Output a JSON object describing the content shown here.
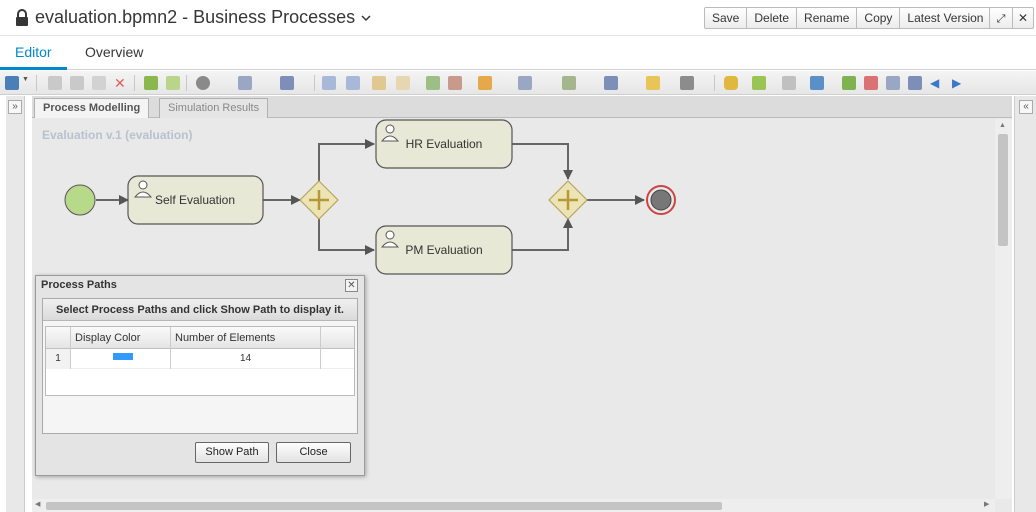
{
  "header": {
    "title": "evaluation.bpmn2 - Business Processes",
    "buttons": {
      "save": "Save",
      "delete": "Delete",
      "rename": "Rename",
      "copy": "Copy",
      "version": "Latest Version"
    }
  },
  "tabs": {
    "editor": "Editor",
    "overview": "Overview"
  },
  "canvas_tabs": {
    "modelling": "Process Modelling",
    "simulation": "Simulation Results"
  },
  "process": {
    "label": "Evaluation v.1 (evaluation)",
    "tasks": {
      "self": "Self Evaluation",
      "hr": "HR Evaluation",
      "pm": "PM Evaluation"
    }
  },
  "dialog": {
    "title": "Process Paths",
    "instruction": "Select Process Paths and click Show Path to display it.",
    "columns": {
      "color": "Display Color",
      "count": "Number of Elements"
    },
    "rows": [
      {
        "index": "1",
        "color": "#3399ff",
        "count": "14"
      }
    ],
    "show_path": "Show Path",
    "close": "Close"
  },
  "colors": {
    "accent": "#0088ce",
    "task_fill": "#e8e8d6",
    "gateway_fill": "#ece4b4",
    "start_fill": "#b7d98a"
  }
}
